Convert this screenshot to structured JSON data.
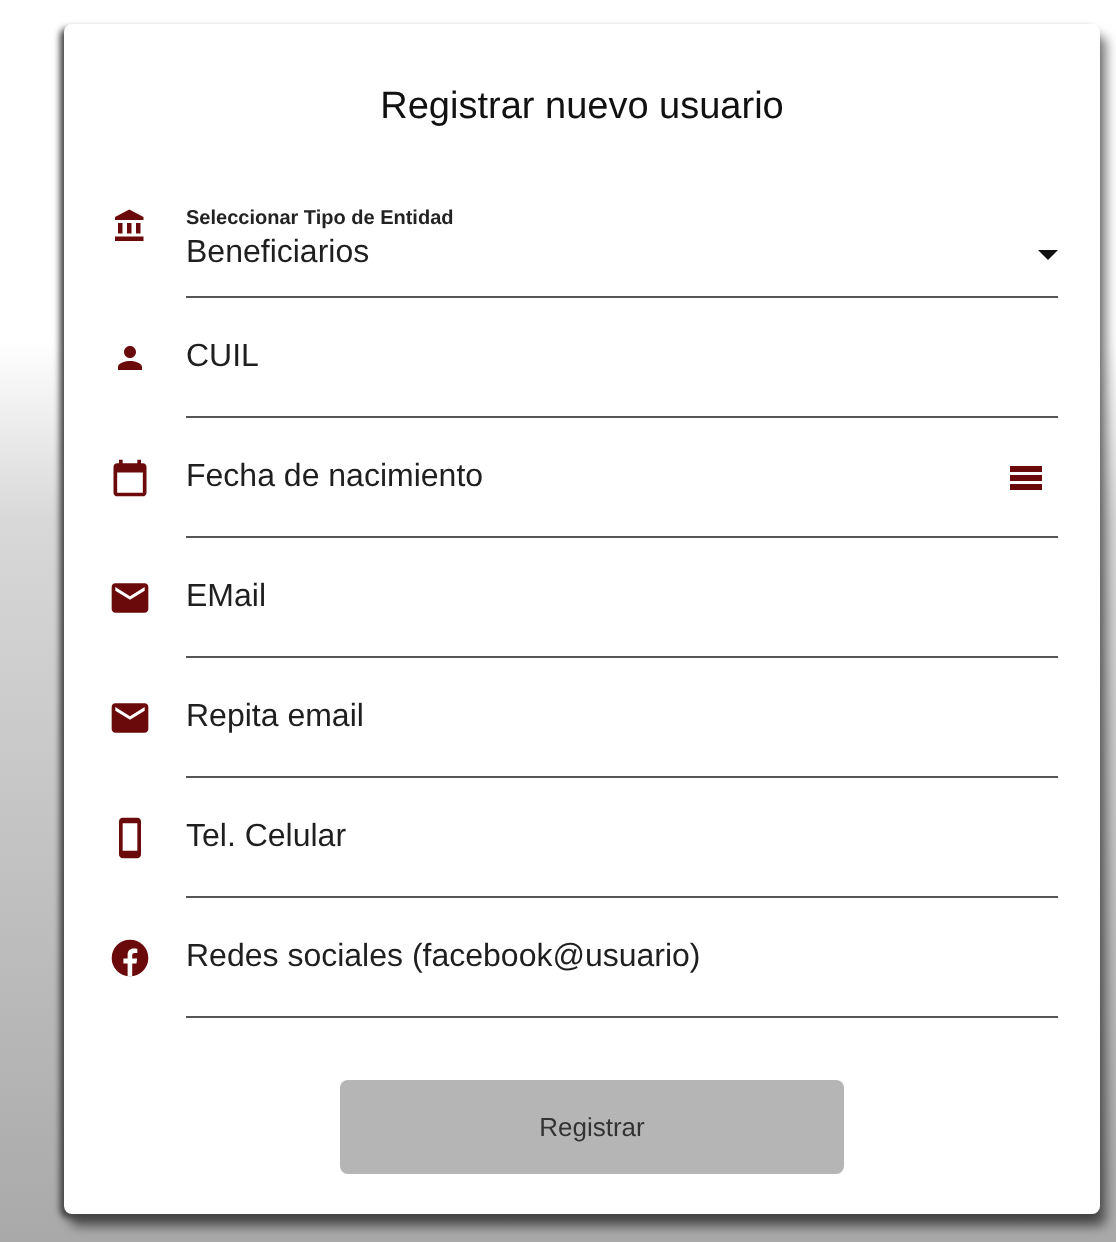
{
  "title": "Registrar nuevo usuario",
  "fields": [
    {
      "kind": "select",
      "label": "Seleccionar Tipo de Entidad",
      "value": "Beneficiarios"
    },
    {
      "kind": "cuil",
      "placeholder": "CUIL"
    },
    {
      "kind": "date",
      "placeholder": "Fecha de nacimiento"
    },
    {
      "kind": "email",
      "placeholder": "EMail"
    },
    {
      "kind": "email",
      "placeholder": "Repita email"
    },
    {
      "kind": "phone",
      "placeholder": "Tel. Celular"
    },
    {
      "kind": "social",
      "placeholder": "Redes sociales (facebook@usuario)"
    }
  ],
  "submit": {
    "label": "Registrar",
    "disabled": true
  }
}
